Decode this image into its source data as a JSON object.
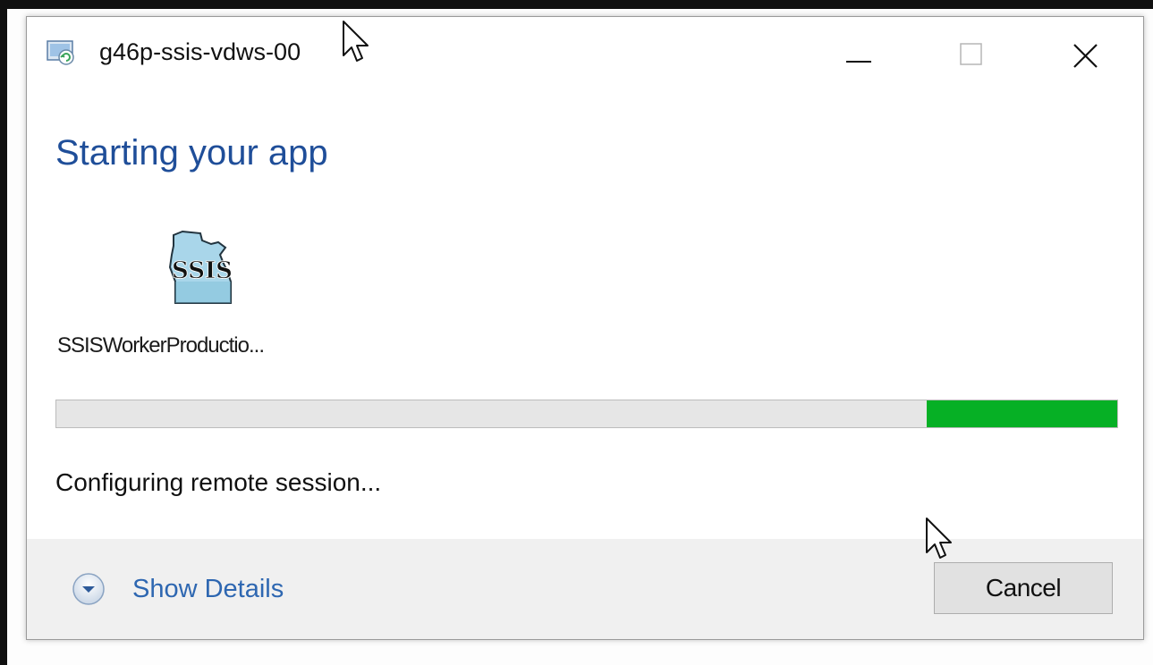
{
  "window": {
    "title": "g46p-ssis-vdws-00",
    "minimize_icon": "minimize-icon",
    "maximize_icon": "maximize-icon",
    "close_icon": "close-icon"
  },
  "content": {
    "heading": "Starting your app",
    "app_icon_text": "SSIS",
    "app_name": "SSISWorkerProductio...",
    "progress_fraction": 0.18,
    "status": "Configuring remote session..."
  },
  "footer": {
    "show_details_label": "Show Details",
    "cancel_label": "Cancel"
  },
  "colors": {
    "heading": "#1f4e99",
    "progress_fill": "#06b025",
    "link": "#2e67b1"
  }
}
